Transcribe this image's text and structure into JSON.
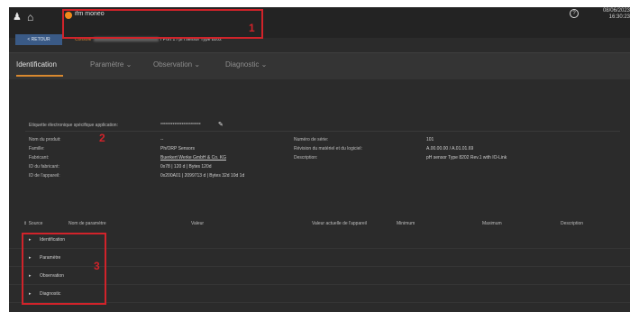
{
  "header": {
    "app_title": "ifm moneo",
    "back_label": "< RETOUR",
    "crumb_root": "Console",
    "crumb_rest": "/ Port 1 / pH sensor Type 8202",
    "clock_date": "08/06/2023",
    "clock_time": "16:30:23"
  },
  "tabs": [
    {
      "label": "Identification"
    },
    {
      "label": "Paramètre ⌄"
    },
    {
      "label": "Observation ⌄"
    },
    {
      "label": "Diagnostic ⌄"
    }
  ],
  "identification": {
    "tag_label": "Etiquette électronique spécifique application:",
    "tag_value": "***********************",
    "left": [
      {
        "label": "Nom du produit:",
        "value": "--"
      },
      {
        "label": "Famille:",
        "value": "Ph/ORP Sensors"
      },
      {
        "label": "Fabricant:",
        "value": "Buerkert Werke GmbH & Co. KG"
      },
      {
        "label": "ID du fabricant:",
        "value": "0x78 | 120 d | Bytes 120d"
      },
      {
        "label": "ID de l'appareil:",
        "value": "0x200A01 | 2099713 d | Bytes 32d 10d 1d"
      }
    ],
    "right": [
      {
        "label": "Numéro de série:",
        "value": "101"
      },
      {
        "label": "Révision du matériel et du logiciel:",
        "value": "A.00.00.00 / A.01.01.69"
      },
      {
        "label": "Description:",
        "value": "pH sensor Type 8202 Rev.1 with IO-Link"
      }
    ]
  },
  "table": {
    "columns": [
      "Source",
      "Nom de paramètre",
      "Valeur",
      "Valeur actuelle de l'appareil",
      "Minimum",
      "Maximum",
      "Description"
    ],
    "rows": [
      {
        "label": "Identification"
      },
      {
        "label": "Paramètre"
      },
      {
        "label": "Observation"
      },
      {
        "label": "Diagnostic"
      }
    ]
  },
  "annotations": [
    "1",
    "2",
    "3"
  ],
  "colors": {
    "accent": "#d9892f",
    "annotation": "#d1232a",
    "back_button": "#3a5a86"
  }
}
